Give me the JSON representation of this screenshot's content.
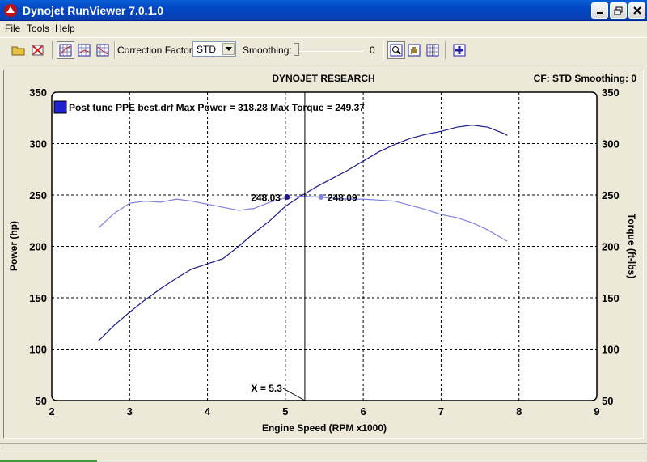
{
  "window": {
    "title": "Dynojet RunViewer 7.0.1.0"
  },
  "menu": [
    "File",
    "Tools",
    "Help"
  ],
  "toolbar": {
    "correction_label": "Correction Factor:",
    "correction_value": "STD",
    "smoothing_label": "Smoothing:",
    "smoothing_value": "0"
  },
  "icons": {
    "app": "dyno-logo-icon",
    "open": "open-folder-icon",
    "close_run": "close-run-icon",
    "graph_hp_tq": "graph-icon",
    "graph_2": "graph-icon",
    "graph_3": "graph-icon",
    "zoom": "zoom-icon",
    "pan": "hand-icon",
    "cursor": "cursor-icon",
    "settings": "settings-icon"
  },
  "colors": {
    "power_line": "#1a1a8c",
    "torque_line": "#8080e0",
    "plot_bg": "#ffffff",
    "legend_swatch": "#2020d0"
  },
  "chart_data": {
    "type": "line",
    "title": "DYNOJET RESEARCH",
    "header_right": "CF: STD  Smoothing: 0",
    "xlabel": "Engine Speed (RPM x1000)",
    "ylabel": "Power (hp)",
    "y2label": "Torque (ft-lbs)",
    "xlim": [
      2,
      9
    ],
    "ylim": [
      50,
      350
    ],
    "y2lim": [
      50,
      350
    ],
    "x_ticks": [
      "2",
      "3",
      "4",
      "5",
      "6",
      "7",
      "8",
      "9"
    ],
    "y_ticks": [
      "50",
      "100",
      "150",
      "200",
      "250",
      "300",
      "350"
    ],
    "grid": true,
    "legend": "Post tune PPE best.drf Max Power = 318.28 Max Torque = 249.37",
    "cursor": {
      "x": 5.25,
      "label": "X = 5.3",
      "power_value": 248.03,
      "power_label": "248.03",
      "torque_value": 248.09,
      "torque_label": "248.09"
    },
    "series": [
      {
        "role": "power",
        "x": [
          2.6,
          2.8,
          3.0,
          3.2,
          3.4,
          3.6,
          3.8,
          4.0,
          4.2,
          4.4,
          4.6,
          4.8,
          5.0,
          5.2,
          5.4,
          5.6,
          5.8,
          6.0,
          6.2,
          6.4,
          6.6,
          6.8,
          7.0,
          7.2,
          7.4,
          7.6,
          7.8,
          7.85
        ],
        "values": [
          108,
          123,
          136,
          148,
          159,
          169,
          178,
          183,
          188,
          200,
          213,
          225,
          239,
          249,
          258,
          266,
          274,
          283,
          292,
          299,
          305,
          309,
          312,
          316,
          318,
          316,
          310,
          308
        ]
      },
      {
        "role": "torque",
        "x": [
          2.6,
          2.8,
          3.0,
          3.2,
          3.4,
          3.6,
          3.8,
          4.0,
          4.2,
          4.4,
          4.6,
          4.8,
          5.0,
          5.2,
          5.4,
          5.6,
          5.8,
          6.0,
          6.2,
          6.4,
          6.6,
          6.8,
          7.0,
          7.2,
          7.4,
          7.6,
          7.8,
          7.85
        ],
        "values": [
          218,
          232,
          242,
          244,
          243,
          246,
          244,
          241,
          238,
          235,
          237,
          243,
          247,
          249,
          248,
          247,
          246,
          246,
          245,
          244,
          240,
          236,
          231,
          228,
          223,
          216,
          207,
          205
        ]
      }
    ]
  }
}
